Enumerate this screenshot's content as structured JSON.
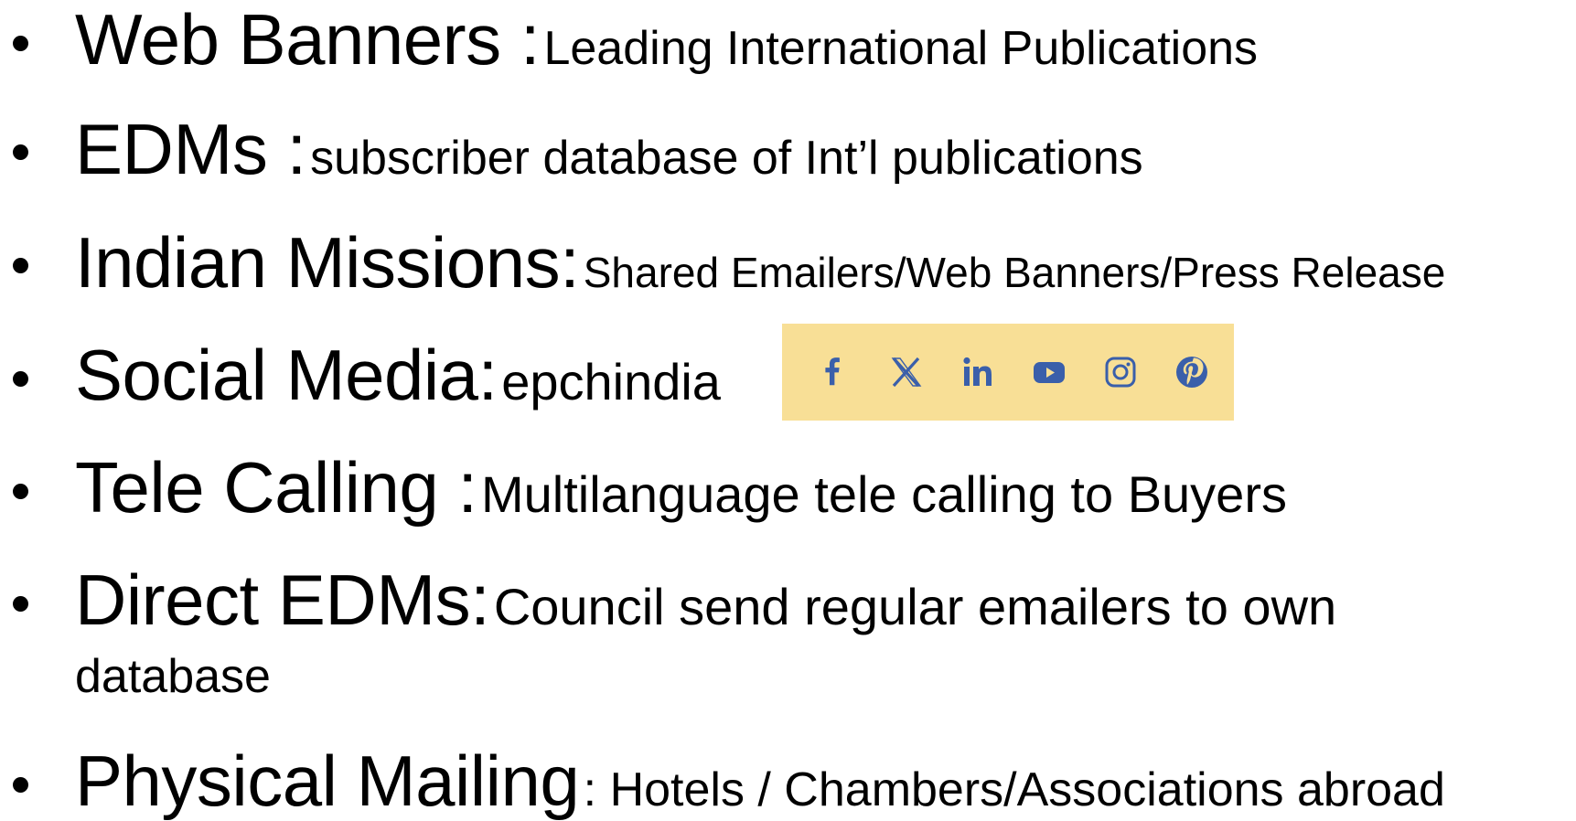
{
  "items": [
    {
      "term": "Web Banners :",
      "desc": "Leading International Publications"
    },
    {
      "term": "EDMs :",
      "desc": "subscriber database of  Int’l publications"
    },
    {
      "term": "Indian Missions:",
      "desc": "Shared Emailers/Web Banners/Press Release"
    },
    {
      "term": "Social Media:",
      "desc": "epchindia"
    },
    {
      "term": "Tele Calling :",
      "desc": "Multilanguage tele calling to Buyers"
    },
    {
      "term": "Direct EDMs:",
      "desc": "Council send regular emailers to own",
      "desc_cont": "database"
    },
    {
      "term": "Physical Mailing",
      "desc": ": Hotels / Chambers/Associations abroad"
    }
  ],
  "social_icons": [
    "facebook-icon",
    "x-twitter-icon",
    "linkedin-icon",
    "youtube-icon",
    "instagram-icon",
    "pinterest-icon"
  ],
  "colors": {
    "social_bar_bg": "#f8df96",
    "social_icon": "#3a5faa",
    "text": "#000000"
  }
}
